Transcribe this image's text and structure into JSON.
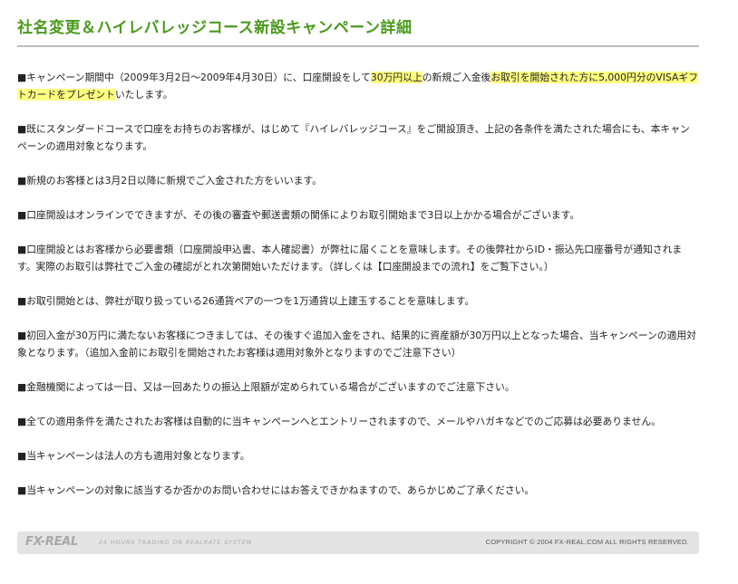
{
  "title": "社名変更＆ハイレバレッジコース新設キャンペーン詳細",
  "paragraphs": [
    {
      "parts": [
        {
          "text": "■キャンペーン期間中（2009年3月2日～2009年4月30日）に、口座開設をして",
          "highlight": false
        },
        {
          "text": "30万円以上",
          "highlight": true
        },
        {
          "text": "の新規ご入金後",
          "highlight": false
        },
        {
          "text": "お取引を開始された方に5,000円分のVISAギフトカードをプレゼント",
          "highlight": true
        },
        {
          "text": "いたします。",
          "highlight": false
        }
      ]
    },
    {
      "parts": [
        {
          "text": "■既にスタンダードコースで口座をお持ちのお客様が、はじめて『ハイレバレッジコース』をご開設頂き、上記の各条件を満たされた場合にも、本キャンペーンの適用対象となります。",
          "highlight": false
        }
      ]
    },
    {
      "parts": [
        {
          "text": "■新規のお客様とは3月2日以降に新規でご入金された方をいいます。",
          "highlight": false
        }
      ]
    },
    {
      "parts": [
        {
          "text": "■口座開設はオンラインでできますが、その後の審査や郵送書類の関係によりお取引開始まで3日以上かかる場合がございます。",
          "highlight": false
        }
      ]
    },
    {
      "parts": [
        {
          "text": "■口座開設とはお客様から必要書類（口座開設申込書、本人確認書）が弊社に届くことを意味します。その後弊社からID・振込先口座番号が通知されます。実際のお取引は弊社でご入金の確認がとれ次第開始いただけます。（詳しくは【口座開設までの流れ】をご覧下さい。）",
          "highlight": false
        }
      ]
    },
    {
      "parts": [
        {
          "text": "■お取引開始とは、弊社が取り扱っている26通貨ペアの一つを1万通貨以上建玉することを意味します。",
          "highlight": false
        }
      ]
    },
    {
      "parts": [
        {
          "text": "■初回入金が30万円に満たないお客様につきましては、その後すぐ追加入金をされ、結果的に資産額が30万円以上となった場合、当キャンペーンの適用対象となります。（追加入金前にお取引を開始されたお客様は適用対象外となりますのでご注意下さい）",
          "highlight": false
        }
      ]
    },
    {
      "parts": [
        {
          "text": "■金融機関によっては一日、又は一回あたりの振込上限額が定められている場合がございますのでご注意下さい。",
          "highlight": false
        }
      ]
    },
    {
      "parts": [
        {
          "text": "■全ての適用条件を満たされたお客様は自動的に当キャンペーンへとエントリーされますので、メールやハガキなどでのご応募は必要ありません。",
          "highlight": false
        }
      ]
    },
    {
      "parts": [
        {
          "text": "■当キャンペーンは法人の方も適用対象となります。",
          "highlight": false
        }
      ]
    },
    {
      "parts": [
        {
          "text": "■当キャンペーンの対象に該当するか否かのお問い合わせにはお答えできかねますので、あらかじめご了承ください。",
          "highlight": false
        }
      ]
    }
  ],
  "footer": {
    "logo": "FX-REAL",
    "tagline": "24 HOURS TRADING ON REALRATE SYSTEM",
    "copyright": "COPYRIGHT © 2004 FX-REAL.COM ALL RIGHTS RESERVED."
  },
  "colors": {
    "title": "#4a9a1c",
    "highlight": "#ffff80",
    "rule": "#bdbdbd",
    "footer_bg": "#e4e4e4"
  }
}
